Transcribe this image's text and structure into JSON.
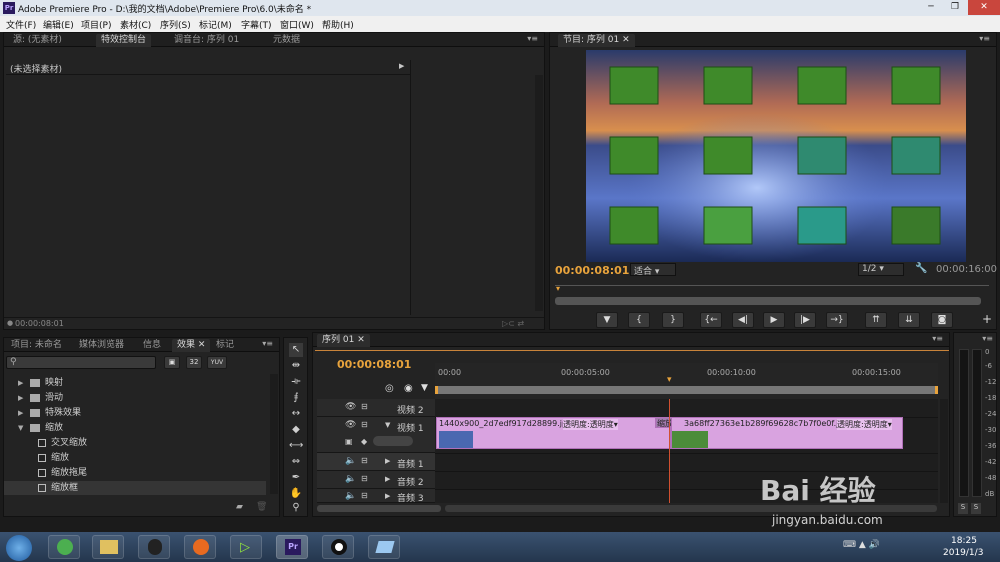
{
  "window": {
    "app_icon": "Pr",
    "title": "Adobe Premiere Pro - D:\\我的文档\\Adobe\\Premiere Pro\\6.0\\未命名 *"
  },
  "menubar": [
    "文件(F)",
    "编辑(E)",
    "项目(P)",
    "素材(C)",
    "序列(S)",
    "标记(M)",
    "字幕(T)",
    "窗口(W)",
    "帮助(H)"
  ],
  "source_panel": {
    "tabs": [
      "源: (无素材)",
      "特效控制台",
      "调音台: 序列 01",
      "元数据"
    ],
    "header": "(未选择素材)",
    "timecode": "00:00:08:01"
  },
  "program_monitor": {
    "tab": "节目: 序列 01",
    "timecode": "00:00:08:01",
    "fit": "适合",
    "resolution": "1/2",
    "duration": "00:00:16:00"
  },
  "project_panel": {
    "tabs": [
      "项目: 未命名",
      "媒体浏览器",
      "信息",
      "效果",
      "标记"
    ],
    "search_placeholder": "",
    "badges": [
      "32",
      "YUV"
    ],
    "tree": [
      {
        "label": "映射",
        "type": "folder",
        "indent": 0,
        "expanded": false
      },
      {
        "label": "滑动",
        "type": "folder",
        "indent": 0,
        "expanded": false
      },
      {
        "label": "特殊效果",
        "type": "folder",
        "indent": 0,
        "expanded": false
      },
      {
        "label": "缩放",
        "type": "folder",
        "indent": 0,
        "expanded": true
      },
      {
        "label": "交叉缩放",
        "type": "effect",
        "indent": 1
      },
      {
        "label": "缩放",
        "type": "effect",
        "indent": 1
      },
      {
        "label": "缩放拖尾",
        "type": "effect",
        "indent": 1
      },
      {
        "label": "缩放框",
        "type": "effect",
        "indent": 1
      }
    ]
  },
  "timeline": {
    "tab": "序列 01",
    "timecode": "00:00:08:01",
    "ruler": [
      "00:00",
      "00:00:05:00",
      "00:00:10:00",
      "00:00:15:00"
    ],
    "tracks": [
      {
        "name": "视频 2"
      },
      {
        "name": "视频 1"
      },
      {
        "name": "音频 1"
      },
      {
        "name": "音频 2"
      },
      {
        "name": "音频 3"
      }
    ],
    "clips": [
      {
        "label": "1440x900_2d7edf917d28899.jpg",
        "effect": "透明度:透明度"
      },
      {
        "label": "缩放框",
        "effect": ""
      },
      {
        "label": "3a68ff27363e1b289f69628c7b7f0e0f.jpg",
        "effect": "透明度:透明度"
      }
    ]
  },
  "meter": {
    "labels": [
      "0",
      "-6",
      "-12",
      "-18",
      "-24",
      "-30",
      "-36",
      "-42",
      "-48",
      "dB"
    ],
    "solo": [
      "S",
      "S"
    ]
  },
  "taskbar": {
    "time": "18:25",
    "date": "2019/1/3"
  },
  "watermark": {
    "brand": "Bai 经验",
    "url": "jingyan.baidu.com"
  },
  "colors": {
    "accent": "#e8a33c",
    "clip": "#d9a3e0"
  }
}
